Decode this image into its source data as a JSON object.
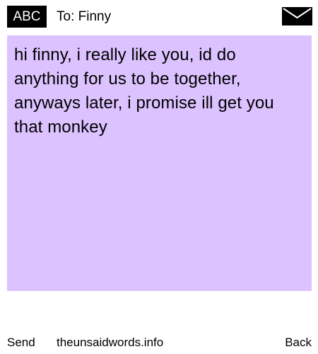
{
  "header": {
    "input_mode": "ABC",
    "recipient": "To: Finny",
    "icon": "envelope-icon"
  },
  "message": {
    "body": "hi finny, i really like you, id do anything for us to be together, anyways later, i promise ill get you that monkey",
    "background_color": "#dcc2ff"
  },
  "footer": {
    "send_label": "Send",
    "site_label": "theunsaidwords.info",
    "back_label": "Back"
  }
}
